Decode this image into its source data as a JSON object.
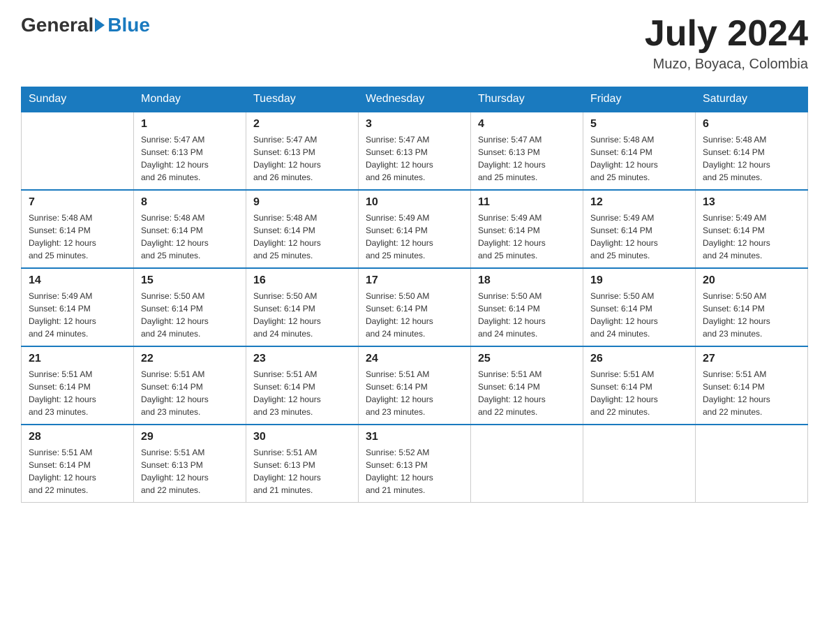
{
  "logo": {
    "general": "General",
    "blue": "Blue"
  },
  "title": "July 2024",
  "location": "Muzo, Boyaca, Colombia",
  "days_of_week": [
    "Sunday",
    "Monday",
    "Tuesday",
    "Wednesday",
    "Thursday",
    "Friday",
    "Saturday"
  ],
  "weeks": [
    [
      {
        "day": "",
        "info": ""
      },
      {
        "day": "1",
        "info": "Sunrise: 5:47 AM\nSunset: 6:13 PM\nDaylight: 12 hours\nand 26 minutes."
      },
      {
        "day": "2",
        "info": "Sunrise: 5:47 AM\nSunset: 6:13 PM\nDaylight: 12 hours\nand 26 minutes."
      },
      {
        "day": "3",
        "info": "Sunrise: 5:47 AM\nSunset: 6:13 PM\nDaylight: 12 hours\nand 26 minutes."
      },
      {
        "day": "4",
        "info": "Sunrise: 5:47 AM\nSunset: 6:13 PM\nDaylight: 12 hours\nand 25 minutes."
      },
      {
        "day": "5",
        "info": "Sunrise: 5:48 AM\nSunset: 6:14 PM\nDaylight: 12 hours\nand 25 minutes."
      },
      {
        "day": "6",
        "info": "Sunrise: 5:48 AM\nSunset: 6:14 PM\nDaylight: 12 hours\nand 25 minutes."
      }
    ],
    [
      {
        "day": "7",
        "info": "Sunrise: 5:48 AM\nSunset: 6:14 PM\nDaylight: 12 hours\nand 25 minutes."
      },
      {
        "day": "8",
        "info": "Sunrise: 5:48 AM\nSunset: 6:14 PM\nDaylight: 12 hours\nand 25 minutes."
      },
      {
        "day": "9",
        "info": "Sunrise: 5:48 AM\nSunset: 6:14 PM\nDaylight: 12 hours\nand 25 minutes."
      },
      {
        "day": "10",
        "info": "Sunrise: 5:49 AM\nSunset: 6:14 PM\nDaylight: 12 hours\nand 25 minutes."
      },
      {
        "day": "11",
        "info": "Sunrise: 5:49 AM\nSunset: 6:14 PM\nDaylight: 12 hours\nand 25 minutes."
      },
      {
        "day": "12",
        "info": "Sunrise: 5:49 AM\nSunset: 6:14 PM\nDaylight: 12 hours\nand 25 minutes."
      },
      {
        "day": "13",
        "info": "Sunrise: 5:49 AM\nSunset: 6:14 PM\nDaylight: 12 hours\nand 24 minutes."
      }
    ],
    [
      {
        "day": "14",
        "info": "Sunrise: 5:49 AM\nSunset: 6:14 PM\nDaylight: 12 hours\nand 24 minutes."
      },
      {
        "day": "15",
        "info": "Sunrise: 5:50 AM\nSunset: 6:14 PM\nDaylight: 12 hours\nand 24 minutes."
      },
      {
        "day": "16",
        "info": "Sunrise: 5:50 AM\nSunset: 6:14 PM\nDaylight: 12 hours\nand 24 minutes."
      },
      {
        "day": "17",
        "info": "Sunrise: 5:50 AM\nSunset: 6:14 PM\nDaylight: 12 hours\nand 24 minutes."
      },
      {
        "day": "18",
        "info": "Sunrise: 5:50 AM\nSunset: 6:14 PM\nDaylight: 12 hours\nand 24 minutes."
      },
      {
        "day": "19",
        "info": "Sunrise: 5:50 AM\nSunset: 6:14 PM\nDaylight: 12 hours\nand 24 minutes."
      },
      {
        "day": "20",
        "info": "Sunrise: 5:50 AM\nSunset: 6:14 PM\nDaylight: 12 hours\nand 23 minutes."
      }
    ],
    [
      {
        "day": "21",
        "info": "Sunrise: 5:51 AM\nSunset: 6:14 PM\nDaylight: 12 hours\nand 23 minutes."
      },
      {
        "day": "22",
        "info": "Sunrise: 5:51 AM\nSunset: 6:14 PM\nDaylight: 12 hours\nand 23 minutes."
      },
      {
        "day": "23",
        "info": "Sunrise: 5:51 AM\nSunset: 6:14 PM\nDaylight: 12 hours\nand 23 minutes."
      },
      {
        "day": "24",
        "info": "Sunrise: 5:51 AM\nSunset: 6:14 PM\nDaylight: 12 hours\nand 23 minutes."
      },
      {
        "day": "25",
        "info": "Sunrise: 5:51 AM\nSunset: 6:14 PM\nDaylight: 12 hours\nand 22 minutes."
      },
      {
        "day": "26",
        "info": "Sunrise: 5:51 AM\nSunset: 6:14 PM\nDaylight: 12 hours\nand 22 minutes."
      },
      {
        "day": "27",
        "info": "Sunrise: 5:51 AM\nSunset: 6:14 PM\nDaylight: 12 hours\nand 22 minutes."
      }
    ],
    [
      {
        "day": "28",
        "info": "Sunrise: 5:51 AM\nSunset: 6:14 PM\nDaylight: 12 hours\nand 22 minutes."
      },
      {
        "day": "29",
        "info": "Sunrise: 5:51 AM\nSunset: 6:13 PM\nDaylight: 12 hours\nand 22 minutes."
      },
      {
        "day": "30",
        "info": "Sunrise: 5:51 AM\nSunset: 6:13 PM\nDaylight: 12 hours\nand 21 minutes."
      },
      {
        "day": "31",
        "info": "Sunrise: 5:52 AM\nSunset: 6:13 PM\nDaylight: 12 hours\nand 21 minutes."
      },
      {
        "day": "",
        "info": ""
      },
      {
        "day": "",
        "info": ""
      },
      {
        "day": "",
        "info": ""
      }
    ]
  ]
}
